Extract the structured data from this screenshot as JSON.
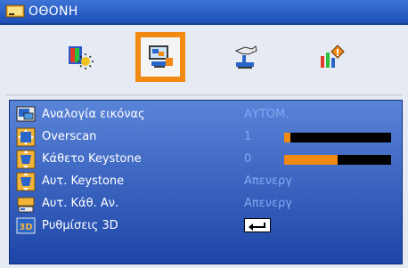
{
  "title": "ΟΘΟΝΗ",
  "tabs": [
    {
      "icon": "image-settings-icon"
    },
    {
      "icon": "display-screen-icon"
    },
    {
      "icon": "setup-hand-icon"
    },
    {
      "icon": "options-bars-icon"
    }
  ],
  "rows": [
    {
      "label": "Αναλογία εικόνας",
      "value": "ΑΥΤΟΜ.",
      "icon": "aspect-ratio-icon"
    },
    {
      "label": "Overscan",
      "value": "1",
      "icon": "overscan-icon",
      "level": 0.06
    },
    {
      "label": "Κάθετο Keystone",
      "value": "0",
      "icon": "keystone-icon",
      "level": 0.5
    },
    {
      "label": "Αυτ. Keystone",
      "value": "Απενεργ",
      "icon": "auto-keystone-icon"
    },
    {
      "label": "Αυτ. Κάθ. Αν.",
      "value": "Απενεργ",
      "icon": "auto-flip-icon"
    },
    {
      "label": "Ρυθμίσεις 3D",
      "icon": "3d-icon",
      "action": "enter-icon"
    }
  ],
  "colors": {
    "accent": "#f08a12",
    "panel": "#1d45a8",
    "value_text": "#7eaaf0",
    "title_bar": "#2e63c9"
  }
}
